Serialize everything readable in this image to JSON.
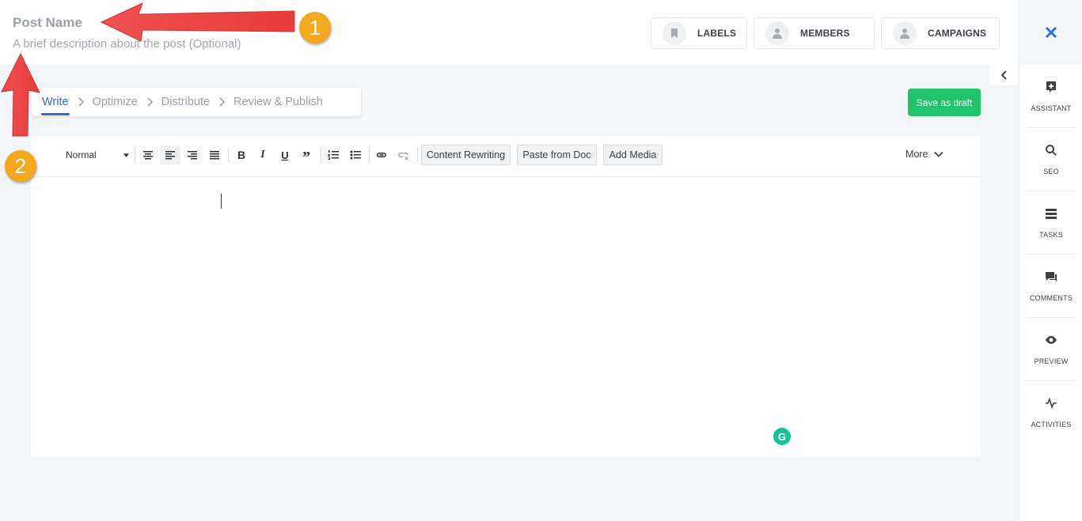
{
  "header": {
    "post_name": "Post Name",
    "description": "A brief description about the post (Optional)",
    "buttons": [
      {
        "label": "LABELS",
        "icon": "bookmark-icon"
      },
      {
        "label": "MEMBERS",
        "icon": "person-icon"
      },
      {
        "label": "CAMPAIGNS",
        "icon": "person-icon"
      }
    ]
  },
  "steps": [
    "Write",
    "Optimize",
    "Distribute",
    "Review & Publish"
  ],
  "save_label": "Save as draft",
  "toolbar": {
    "format": "Normal",
    "content_rewriting": "Content Rewriting",
    "paste_from_doc": "Paste from Doc",
    "add_media": "Add Media",
    "more": "More"
  },
  "sidebar": {
    "items": [
      {
        "label": "ASSISTANT",
        "icon": "add-note-icon"
      },
      {
        "label": "SEO",
        "icon": "search-icon"
      },
      {
        "label": "TASKS",
        "icon": "list-icon"
      },
      {
        "label": "COMMENTS",
        "icon": "comment-icon"
      },
      {
        "label": "PREVIEW",
        "icon": "eye-icon"
      },
      {
        "label": "ACTIVITIES",
        "icon": "activity-icon"
      }
    ]
  },
  "annotations": {
    "badge_1": "1",
    "badge_2": "2"
  },
  "colors": {
    "accent": "#3867d6",
    "save": "#22c46b",
    "arrow": "#ee3b3b",
    "badge": "#f4a81d"
  }
}
